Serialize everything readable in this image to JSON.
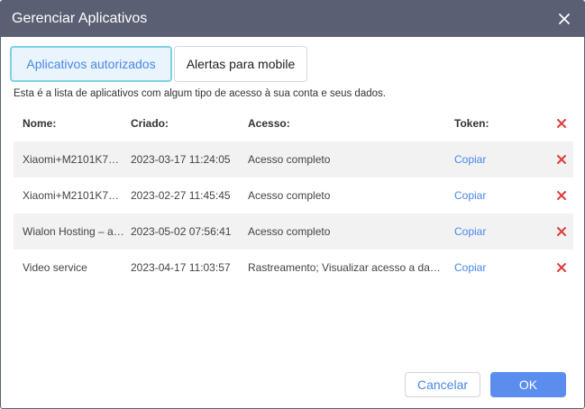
{
  "dialog": {
    "title": "Gerenciar Aplicativos"
  },
  "tabs": [
    {
      "label": "Aplicativos autorizados",
      "active": true
    },
    {
      "label": "Alertas para mobile",
      "active": false
    }
  ],
  "description": "Esta é a lista de aplicativos com algum tipo de acesso à sua conta e seus dados.",
  "table": {
    "headers": {
      "name": "Nome:",
      "created": "Criado:",
      "access": "Acesso:",
      "token": "Token:"
    },
    "rows": [
      {
        "name": "Xiaomi+M2101K7…",
        "created": "2023-03-17 11:24:05",
        "access": "Acesso completo",
        "token": "Copiar"
      },
      {
        "name": "Xiaomi+M2101K7…",
        "created": "2023-02-27 11:45:45",
        "access": "Acesso completo",
        "token": "Copiar"
      },
      {
        "name": "Wialon Hosting – a…",
        "created": "2023-05-02 07:56:41",
        "access": "Acesso completo",
        "token": "Copiar"
      },
      {
        "name": "Video service",
        "created": "2023-04-17 11:03:57",
        "access": "Rastreamento; Visualizar acesso a da…",
        "token": "Copiar"
      }
    ]
  },
  "footer": {
    "cancel_label": "Cancelar",
    "ok_label": "OK"
  },
  "colors": {
    "titlebar": "#5a5f73",
    "accent": "#4a87e8",
    "delete": "#e03c3c",
    "ok_button": "#5b8def"
  },
  "icons": {
    "close": "close-icon",
    "delete": "delete-x-icon"
  }
}
